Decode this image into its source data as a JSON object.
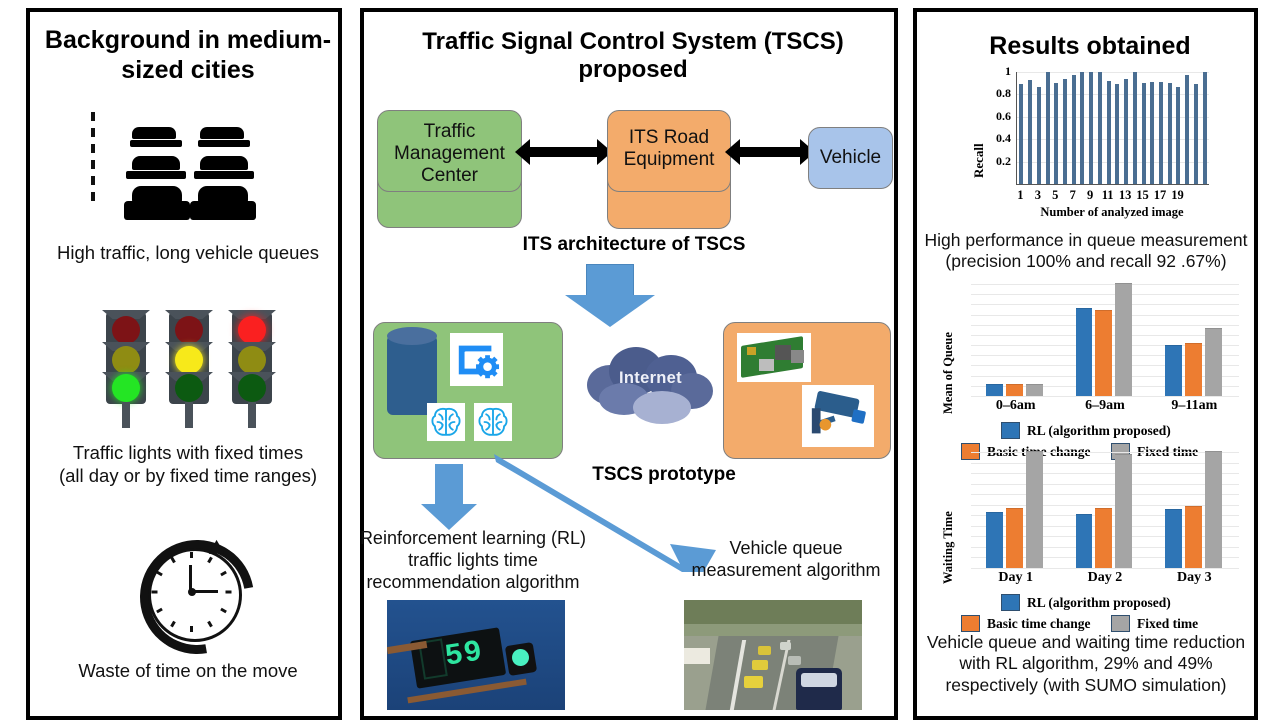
{
  "panels": {
    "left": {
      "title": "Background in medium-sized cities",
      "captions": [
        "High traffic, long vehicle queues",
        "Traffic lights with fixed times\n(all day or by fixed time ranges)",
        "Waste of time on the move"
      ],
      "icons": [
        "car-queue-icon",
        "traffic-lights-icon",
        "clock-icon"
      ]
    },
    "middle": {
      "title": "Traffic  Signal Control System (TSCS) proposed",
      "architecture": {
        "caption": "ITS architecture of TSCS",
        "nodes": [
          {
            "label": "Traffic Management Center",
            "color": "#8FC47A"
          },
          {
            "label": "ITS Road Equipment",
            "color": "#F3AB6B"
          },
          {
            "label": "Vehicle",
            "color": "#A8C4EA"
          }
        ]
      },
      "prototype": {
        "caption": "TSCS prototype",
        "cloud_label": "Internet",
        "server_icons": [
          "database-icon",
          "software-window-gear-icon",
          "brain-icon",
          "brain-icon"
        ],
        "field_icons": [
          "raspberry-pi-photo",
          "cctv-camera-icon"
        ]
      },
      "outputs": [
        {
          "label": "Reinforcement learning (RL)\ntraffic lights time\nrecommendation algorithm",
          "image": "countdown-traffic-light-photo"
        },
        {
          "label": "Vehicle queue\nmeasurement  algorithm",
          "image": "road-traffic-queue-photo"
        }
      ]
    },
    "right": {
      "title": "Results obtained",
      "captions": [
        "High performance in queue measurement\n(precision 100% and recall 92 .67%)",
        "Vehicle queue and waiting time reduction\nwith RL algorithm, 29% and 49%\nrespectively (with SUMO simulation)"
      ]
    }
  },
  "colors": {
    "green": "#8FC47A",
    "orange": "#F3AB6B",
    "blue_node": "#A8C4EA",
    "arrow_blue": "#5B9BD5",
    "series_rl": "#2E75B6",
    "series_basic": "#ED7D31",
    "series_fixed": "#A5A5A5",
    "recall_bar": "#4A6E92",
    "black": "#000000"
  },
  "chart_data": [
    {
      "type": "bar",
      "title": "",
      "xlabel": "Number of analyzed image",
      "ylabel": "Recall",
      "categories": [
        "1",
        "2",
        "3",
        "4",
        "5",
        "6",
        "7",
        "8",
        "9",
        "10",
        "11",
        "12",
        "13",
        "14",
        "15",
        "16",
        "17",
        "18",
        "19"
      ],
      "tick_labels": [
        "1",
        "3",
        "5",
        "7",
        "9",
        "11",
        "13",
        "15",
        "17",
        "19"
      ],
      "values": [
        0.89,
        0.93,
        0.87,
        1.0,
        0.9,
        0.94,
        0.97,
        1.0,
        1.0,
        1.0,
        0.92,
        0.89,
        0.94,
        1.0,
        0.9,
        0.91,
        0.91,
        0.9,
        0.87,
        0.97,
        0.89,
        1.0
      ],
      "ylim": [
        0,
        1.0
      ],
      "yticks": [
        0.2,
        0.4,
        0.6,
        0.8,
        1
      ],
      "grid": true,
      "series_color": "#4A6E92",
      "legend": "none"
    },
    {
      "type": "bar",
      "title": "",
      "xlabel": "",
      "ylabel": "Mean of Queue",
      "categories": [
        "0–6am",
        "6–9am",
        "9–11am"
      ],
      "series": [
        {
          "name": "RL (algorithm proposed)",
          "color": "#2E75B6",
          "values": [
            8,
            62,
            36
          ]
        },
        {
          "name": "Basic time change",
          "color": "#ED7D31",
          "values": [
            8,
            61,
            37
          ]
        },
        {
          "name": "Fixed time",
          "color": "#A5A5A5",
          "values": [
            8,
            80,
            48
          ]
        }
      ],
      "ylim": [
        0,
        80
      ],
      "grid": true,
      "legend": "bottom"
    },
    {
      "type": "bar",
      "title": "",
      "xlabel": "",
      "ylabel": "Waiting Time",
      "categories": [
        "Day 1",
        "Day 2",
        "Day 3"
      ],
      "series": [
        {
          "name": "RL (algorithm proposed)",
          "color": "#2E75B6",
          "values": [
            47,
            46,
            50
          ]
        },
        {
          "name": "Basic time change",
          "color": "#ED7D31",
          "values": [
            51,
            51,
            53
          ]
        },
        {
          "name": "Fixed time",
          "color": "#A5A5A5",
          "values": [
            100,
            97,
            100
          ]
        }
      ],
      "ylim": [
        0,
        100
      ],
      "grid": true,
      "legend": "bottom"
    }
  ]
}
